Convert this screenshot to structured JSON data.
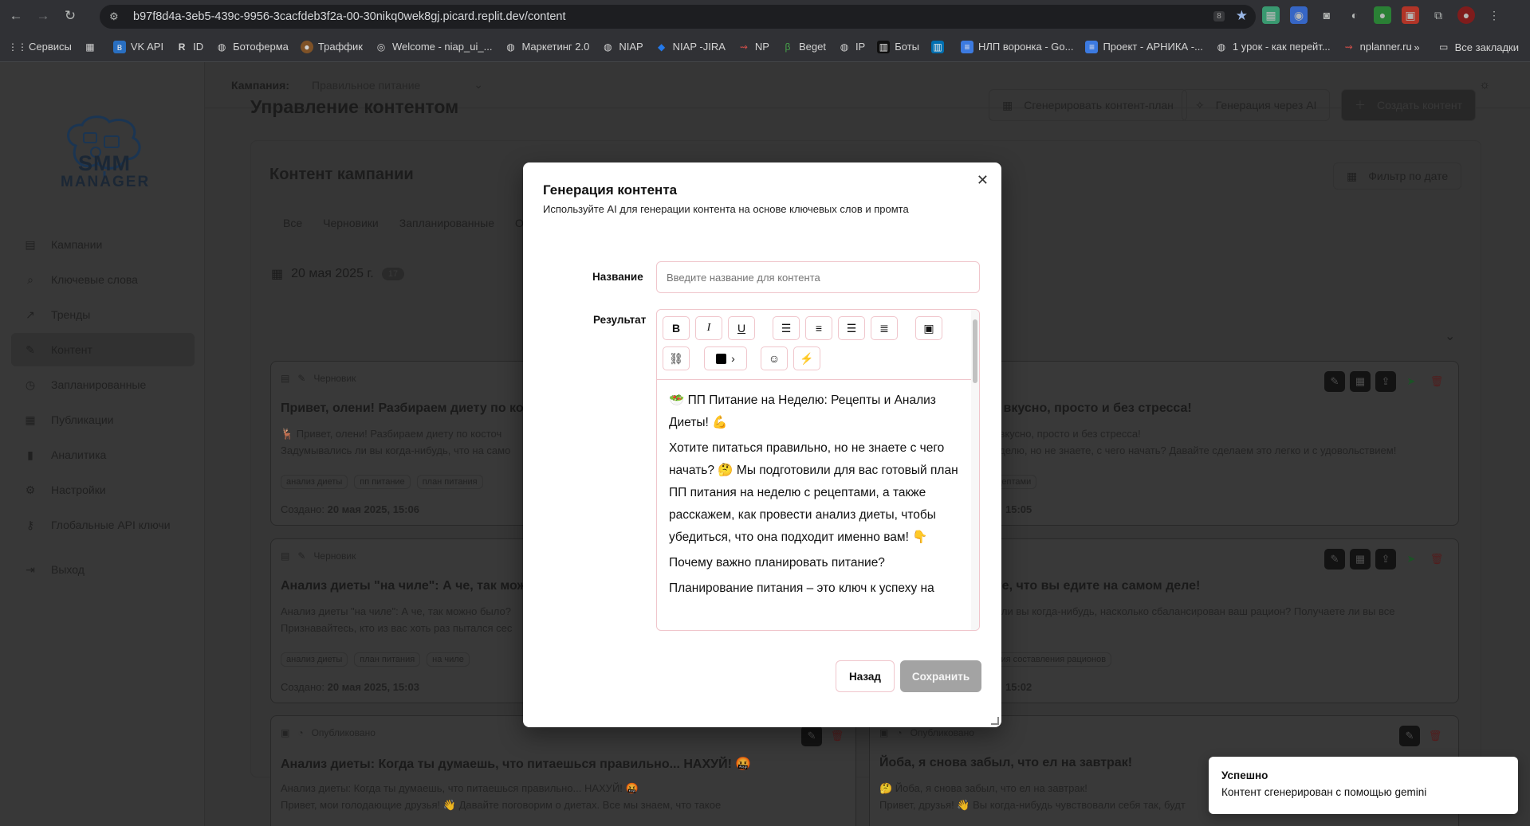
{
  "browser": {
    "url": "b97f8d4a-3eb5-439c-9956-3cacfdeb3f2a-00-30nikq0wek8gj.picard.replit.dev/content",
    "zoom_badge": "8",
    "bookmarks": [
      "Сервисы",
      "VK API",
      "ID",
      "Ботоферма",
      "Траффик",
      "Welcome - niap_ui_...",
      "Маркетинг 2.0",
      "NIAP",
      "NIAP -JIRA",
      "NP",
      "Beget",
      "IP",
      "Боты",
      "",
      "НЛП воронка - Go...",
      "Проект - АРНИКА -...",
      "1 урок - как перейт...",
      "nplanner.ru"
    ],
    "all_bookmarks": "Все закладки",
    "overflow": "»"
  },
  "logo": {
    "line1": "SMM",
    "line2": "MANAGER"
  },
  "sidebar": {
    "items": [
      {
        "label": "Кампании",
        "icon": "file-icon"
      },
      {
        "label": "Ключевые слова",
        "icon": "search-icon"
      },
      {
        "label": "Тренды",
        "icon": "trend-icon"
      },
      {
        "label": "Контент",
        "icon": "pencil-icon"
      },
      {
        "label": "Запланированные",
        "icon": "clock-icon"
      },
      {
        "label": "Публикации",
        "icon": "calendar-icon"
      },
      {
        "label": "Аналитика",
        "icon": "bar-chart-icon"
      },
      {
        "label": "Настройки",
        "icon": "gear-icon"
      },
      {
        "label": "Глобальные API ключи",
        "icon": "key-icon"
      }
    ],
    "logout": "Выход"
  },
  "topbar": {
    "campaign_label": "Кампания:",
    "campaign_value": "Правильное питание"
  },
  "page": {
    "title": "Управление контентом",
    "btn_plan": "Сгенерировать контент-план",
    "btn_ai": "Генерация через AI",
    "btn_create": "Создать контент",
    "panel_title": "Контент кампании",
    "date_filter": "Фильтр по дате",
    "tabs": [
      "Все",
      "Черновики",
      "Запланированные",
      "О"
    ],
    "date": "20 мая 2025 г.",
    "date_count": "17"
  },
  "cards": [
    {
      "status": "Черновик",
      "title": "Привет, олени! Разбираем диету по кост",
      "line1": "🦌 Привет, олени! Разбираем диету по косточ",
      "line2": "Задумывались ли вы когда-нибудь, что на само",
      "tags": [
        "анализ диеты",
        "пп питание",
        "план питания"
      ],
      "created_label": "Создано:",
      "created": "20 мая 2025, 15:06"
    },
    {
      "status": "Черновик",
      "title": "Анализ диеты \"на чиле\": А че, так можно",
      "line1": "Анализ диеты \"на чиле\": А че, так можно было?",
      "line2": "Признавайтесь, кто из вас хоть раз пытался сес",
      "tags": [
        "анализ диеты",
        "план питания",
        "на чиле"
      ],
      "created_label": "Создано:",
      "created": "20 мая 2025, 15:03"
    },
    {
      "status": "Опубликовано",
      "title": "Анализ диеты: Когда ты думаешь, что питаешься правильно... НАХУЙ! 🤬",
      "line1": "Анализ диеты: Когда ты думаешь, что питаешься правильно... НАХУЙ! 🤬",
      "line2": "Привет, мои голодающие друзья! 👋 Давайте поговорим о диетах. Все мы знаем, что такое"
    },
    {
      "title": "о: вкусно, просто и без стресса!",
      "line1": "о: вкусно, просто и без стресса!",
      "line2": "неделю, но не знаете, с чего начать? Давайте сделаем это легко и с удовольствием!",
      "tags": [
        "рецептами"
      ],
      "created": "15:05"
    },
    {
      "title": "йте, что вы едите на самом деле!",
      "line1": "сь ли вы когда-нибудь, насколько сбалансирован ваш рацион? Получаете ли вы все",
      "line2": "те, что вы едите на самом деле!",
      "tags": [
        "зация составления рационов"
      ],
      "created": "15:02"
    },
    {
      "status": "Опубликовано",
      "title": "Йоба, я снова забыл, что ел на завтрак!",
      "line1": "🤔 Йоба, я снова забыл, что ел на завтрак!",
      "line2": "Привет, друзья! 👋 Вы когда-нибудь чувствовали себя так, будт"
    }
  ],
  "modal": {
    "title": "Генерация контента",
    "description": "Используйте AI для генерации контента на основе ключевых слов и промта",
    "name_label": "Название",
    "name_placeholder": "Введите название для контента",
    "result_label": "Результат",
    "toolbar_icons": [
      "bold-icon",
      "italic-icon",
      "underline-icon",
      "align-left-icon",
      "align-center-icon",
      "align-right-icon",
      "align-justify-icon",
      "image-icon",
      "link-icon",
      "color-picker-icon",
      "emoji-icon",
      "magic-wand-icon"
    ],
    "content": [
      "🥗 ПП Питание на Неделю: Рецепты и Анализ Диеты! 💪",
      "Хотите питаться правильно, но не знаете с чего начать? 🤔 Мы подготовили для вас готовый план ПП питания на неделю с рецептами, а также расскажем, как провести анализ диеты, чтобы убедиться, что она подходит именно вам! 👇",
      "Почему важно планировать питание?",
      "Планирование питания – это ключ к успеху на"
    ],
    "btn_back": "Назад",
    "btn_save": "Сохранить"
  },
  "toast": {
    "title": "Успешно",
    "message": "Контент сгенерирован с помощью gemini"
  }
}
